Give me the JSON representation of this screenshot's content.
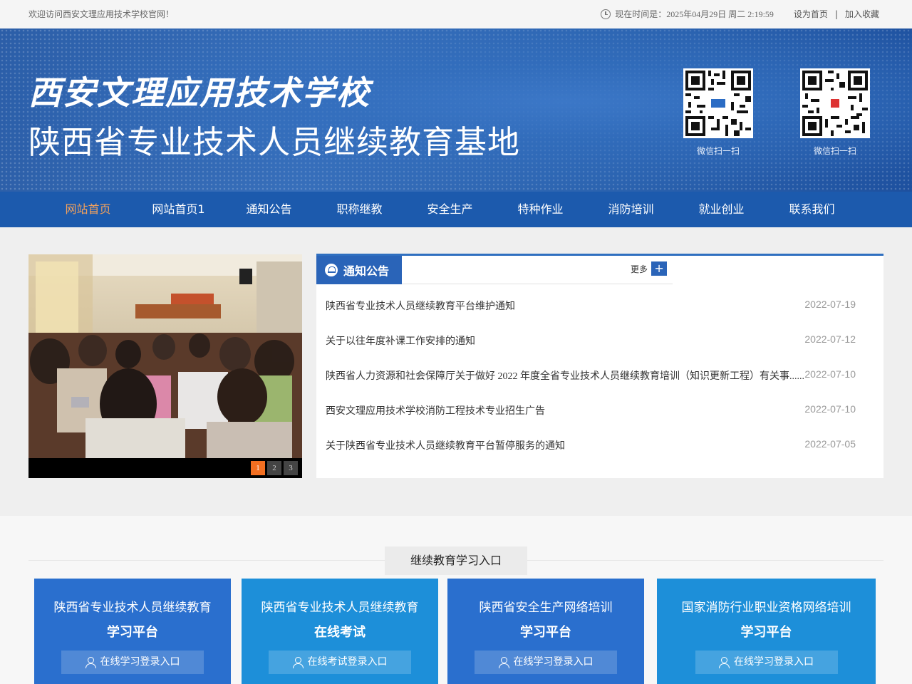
{
  "topbar": {
    "welcome": "欢迎访问西安文理应用技术学校官网！",
    "time": "现在时间是：2025年04月29日 周二 2:19:59",
    "set_home": "设为首页",
    "sep": "|",
    "favorite": "加入收藏"
  },
  "banner": {
    "school_name": "西安文理应用技术学校",
    "base_name": "陕西省专业技术人员继续教育基地",
    "qr": [
      {
        "caption": "微信扫一扫"
      },
      {
        "caption": "微信扫一扫"
      }
    ]
  },
  "nav": {
    "items": [
      "网站首页",
      "网站首页1",
      "通知公告",
      "职称继教",
      "安全生产",
      "特种作业",
      "消防培训",
      "就业创业",
      "联系我们"
    ],
    "active_index": 0
  },
  "slider": {
    "pages": [
      "1",
      "2",
      "3"
    ],
    "current": 1
  },
  "notice": {
    "title": "通知公告",
    "more": "更多",
    "plus": "+",
    "items": [
      {
        "title": "陕西省专业技术人员继续教育平台维护通知",
        "date": "2022-07-19"
      },
      {
        "title": "关于以往年度补课工作安排的通知",
        "date": "2022-07-12"
      },
      {
        "title": "陕西省人力资源和社会保障厅关于做好 2022 年度全省专业技术人员继续教育培训（知识更新工程）有关事......",
        "date": "2022-07-10"
      },
      {
        "title": "西安文理应用技术学校消防工程技术专业招生广告",
        "date": "2022-07-10"
      },
      {
        "title": "关于陕西省专业技术人员继续教育平台暂停服务的通知",
        "date": "2022-07-05"
      }
    ]
  },
  "study": {
    "title": "继续教育学习入口",
    "cards": [
      {
        "line1": "陕西省专业技术人员继续教育",
        "line2": "学习平台",
        "button": "在线学习登录入口",
        "color": "#2a6fce"
      },
      {
        "line1": "陕西省专业技术人员继续教育",
        "line2": "在线考试",
        "button": "在线考试登录入口",
        "color": "#1d8fd9"
      },
      {
        "line1": "陕西省安全生产网络培训",
        "line2": "学习平台",
        "button": "在线学习登录入口",
        "color": "#2a6fce"
      },
      {
        "line1": "国家消防行业职业资格网络培训",
        "line2": "学习平台",
        "button": "在线学习登录入口",
        "color": "#1d8fd9"
      }
    ]
  }
}
